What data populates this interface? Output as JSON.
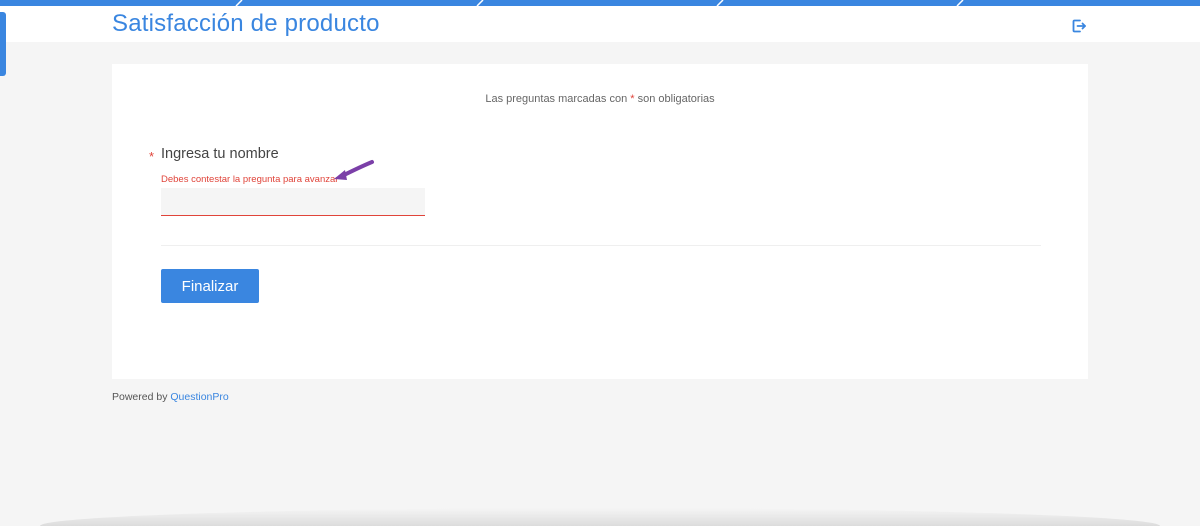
{
  "header": {
    "title": "Satisfacción de producto",
    "logout_icon": "logout-icon"
  },
  "card": {
    "required_note_prefix": "Las preguntas marcadas con ",
    "required_note_star": "*",
    "required_note_suffix": " son obligatorias"
  },
  "question": {
    "required_marker": "*",
    "label": "Ingresa tu nombre",
    "error": "Debes contestar la pregunta para avanzar",
    "input_value": "",
    "input_placeholder": ""
  },
  "actions": {
    "finish_label": "Finalizar"
  },
  "footer": {
    "powered_prefix": "Powered by ",
    "powered_link": "QuestionPro"
  },
  "colors": {
    "accent": "#3a86e0",
    "error": "#e0443a",
    "annotation_arrow": "#7b3fa8",
    "page_bg": "#f5f5f5",
    "card_bg": "#ffffff"
  }
}
